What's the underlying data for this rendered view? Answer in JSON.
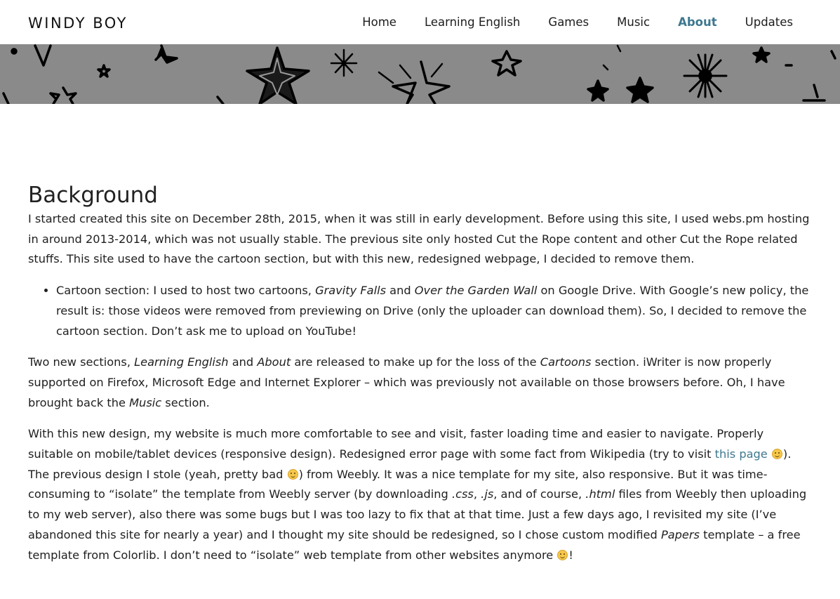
{
  "header": {
    "brand": "WINDY BOY",
    "nav": [
      {
        "label": "Home"
      },
      {
        "label": "Learning English"
      },
      {
        "label": "Games"
      },
      {
        "label": "Music"
      },
      {
        "label": "About"
      },
      {
        "label": "Updates"
      }
    ],
    "active_nav": "About",
    "active_color": "#3e7890"
  },
  "main": {
    "heading": "Background",
    "p1": "I started created this site on December 28th, 2015, when it was still in early development. Before using this site, I used webs.pm hosting in around 2013-2014, which was not usually stable. The previous site only hosted Cut the Rope content and other Cut the Rope related stuffs. This site used to have the cartoon section, but with this new, redesigned webpage, I decided to remove them.",
    "bullet": {
      "a": "Cartoon section: I used to host two cartoons, ",
      "em1": "Gravity Falls",
      "b": " and ",
      "em2": "Over the Garden Wall",
      "c": " on Google Drive. With Google’s new policy, the result is: those videos were removed from previewing on Drive (only the uploader can download them). So, I decided to remove the cartoon section. Don’t ask me to upload on YouTube!"
    },
    "p2": {
      "a": "Two new sections, ",
      "em1": "Learning English",
      "b": " and ",
      "em2": "About",
      "c": " are released to make up for the loss of the ",
      "em3": "Cartoons",
      "d": " section. iWriter is now properly supported on Firefox, Microsoft Edge and Internet Explorer – which was previously not available on those browsers before. Oh, I have brought back the ",
      "em4": "Music",
      "e": " section."
    },
    "p3": {
      "a": "With this new design, my website is much more comfortable to see and visit, faster loading time and easier to navigate. Properly suitable on mobile/tablet devices (responsive design). Redesigned error page with some fact from Wikipedia (try to visit ",
      "link": "this page",
      "b": "). The previous design I stole (yeah, pretty bad ",
      "c": ") from Weebly. It was a nice template for my site, also responsive. But it was time-consuming to “isolate” the template from Weebly server (by downloading ",
      "em1": ".css",
      "d": ", ",
      "em2": ".js",
      "e": ", and of course, ",
      "em3": ".html",
      "f": " files from Weebly then uploading to my web server), also there was some bugs but I was too lazy to fix that at that time. Just a few days ago, I revisited my site (I’ve abandoned this site for nearly a year) and I thought my site should be redesigned, so I chose custom modified ",
      "em4": "Papers",
      "g": " template – a free template from Colorlib. I don’t need to “isolate” web template from other websites anymore ",
      "h": "!"
    }
  }
}
